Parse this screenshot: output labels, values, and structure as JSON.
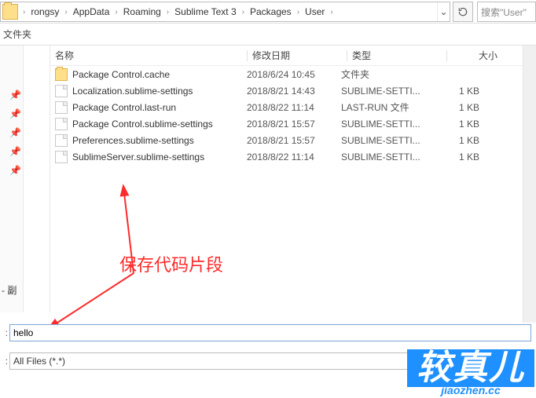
{
  "breadcrumb": {
    "items": [
      "rongsy",
      "AppData",
      "Roaming",
      "Sublime Text 3",
      "Packages",
      "User"
    ]
  },
  "search": {
    "placeholder": "搜索\"User\""
  },
  "toolbar": {
    "folder_label": "文件夹"
  },
  "columns": {
    "name": "名称",
    "date": "修改日期",
    "type": "类型",
    "size": "大小"
  },
  "files": [
    {
      "icon": "folder",
      "name": "Package Control.cache",
      "date": "2018/6/24 10:45",
      "type": "文件夹",
      "size": ""
    },
    {
      "icon": "file",
      "name": "Localization.sublime-settings",
      "date": "2018/8/21 14:43",
      "type": "SUBLIME-SETTI...",
      "size": "1 KB"
    },
    {
      "icon": "file",
      "name": "Package Control.last-run",
      "date": "2018/8/22 11:14",
      "type": "LAST-RUN 文件",
      "size": "1 KB"
    },
    {
      "icon": "file",
      "name": "Package Control.sublime-settings",
      "date": "2018/8/21 15:57",
      "type": "SUBLIME-SETTI...",
      "size": "1 KB"
    },
    {
      "icon": "file",
      "name": "Preferences.sublime-settings",
      "date": "2018/8/21 15:57",
      "type": "SUBLIME-SETTI...",
      "size": "1 KB"
    },
    {
      "icon": "file",
      "name": "SublimeServer.sublime-settings",
      "date": "2018/8/22 11:14",
      "type": "SUBLIME-SETTI...",
      "size": "1 KB"
    }
  ],
  "nav_label": "- 副",
  "annotation": {
    "text": "保存代码片段"
  },
  "filename": {
    "label": ":",
    "value": "hello"
  },
  "filetype": {
    "label": ":",
    "value": "All Files (*.*)"
  },
  "watermark": {
    "main": "较真儿",
    "sub": "jiaozhen.cc"
  }
}
